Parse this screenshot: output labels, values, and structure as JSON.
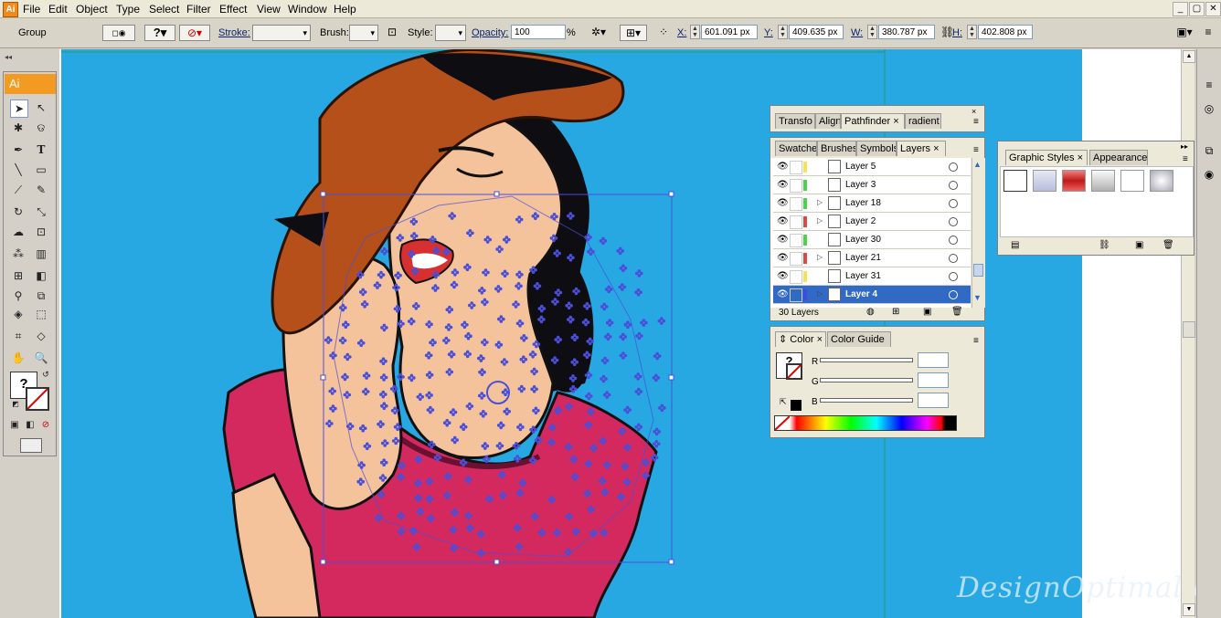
{
  "menubar": {
    "items": [
      "File",
      "Edit",
      "Object",
      "Type",
      "Select",
      "Filter",
      "Effect",
      "View",
      "Window",
      "Help"
    ],
    "window_buttons": [
      "_",
      "▢",
      "✕"
    ]
  },
  "control": {
    "selection_type": "Group",
    "stroke_label": "Stroke:",
    "brush_label": "Brush:",
    "style_label": "Style:",
    "opacity_label": "Opacity:",
    "opacity_value": "100",
    "percent": "%",
    "x_label": "X:",
    "x_value": "601.091 px",
    "y_label": "Y:",
    "y_value": "409.635 px",
    "w_label": "W:",
    "w_value": "380.787 px",
    "h_label": "H:",
    "h_value": "402.808 px"
  },
  "toolbox": {
    "badge": "Ai"
  },
  "panels": {
    "top_tabs": [
      "Transfo",
      "Align",
      "Pathfinder",
      "radient"
    ],
    "layer_tabs": [
      "Swatche",
      "Brushes",
      "Symbols",
      "Layers"
    ],
    "layers": [
      {
        "name": "Layer 5",
        "color": "#f2e35a",
        "expand": false,
        "selected": false
      },
      {
        "name": "Layer 3",
        "color": "#4fd04f",
        "expand": false,
        "selected": false
      },
      {
        "name": "Layer 18",
        "color": "#4fd04f",
        "expand": true,
        "selected": false
      },
      {
        "name": "Layer 2",
        "color": "#e04646",
        "expand": true,
        "selected": false
      },
      {
        "name": "Layer 30",
        "color": "#4fd04f",
        "expand": false,
        "selected": false
      },
      {
        "name": "Layer 21",
        "color": "#e04646",
        "expand": true,
        "selected": false
      },
      {
        "name": "Layer 31",
        "color": "#f2e35a",
        "expand": false,
        "selected": false
      },
      {
        "name": "Layer 4",
        "color": "#3a4ee0",
        "expand": true,
        "selected": true
      }
    ],
    "layer_count": "30 Layers",
    "color_tabs": [
      "Color",
      "Color Guide"
    ],
    "color_channels": [
      "R",
      "G",
      "B"
    ],
    "gs_tabs": [
      "Graphic Styles",
      "Appearance"
    ]
  },
  "watermark": "DesignOptimal.com",
  "colors": {
    "artboard_bg": "#27a8e3",
    "selection": "#4b4fd8",
    "hat": "#b5501b",
    "skin": "#f5c39b",
    "shirt": "#d3295f"
  }
}
